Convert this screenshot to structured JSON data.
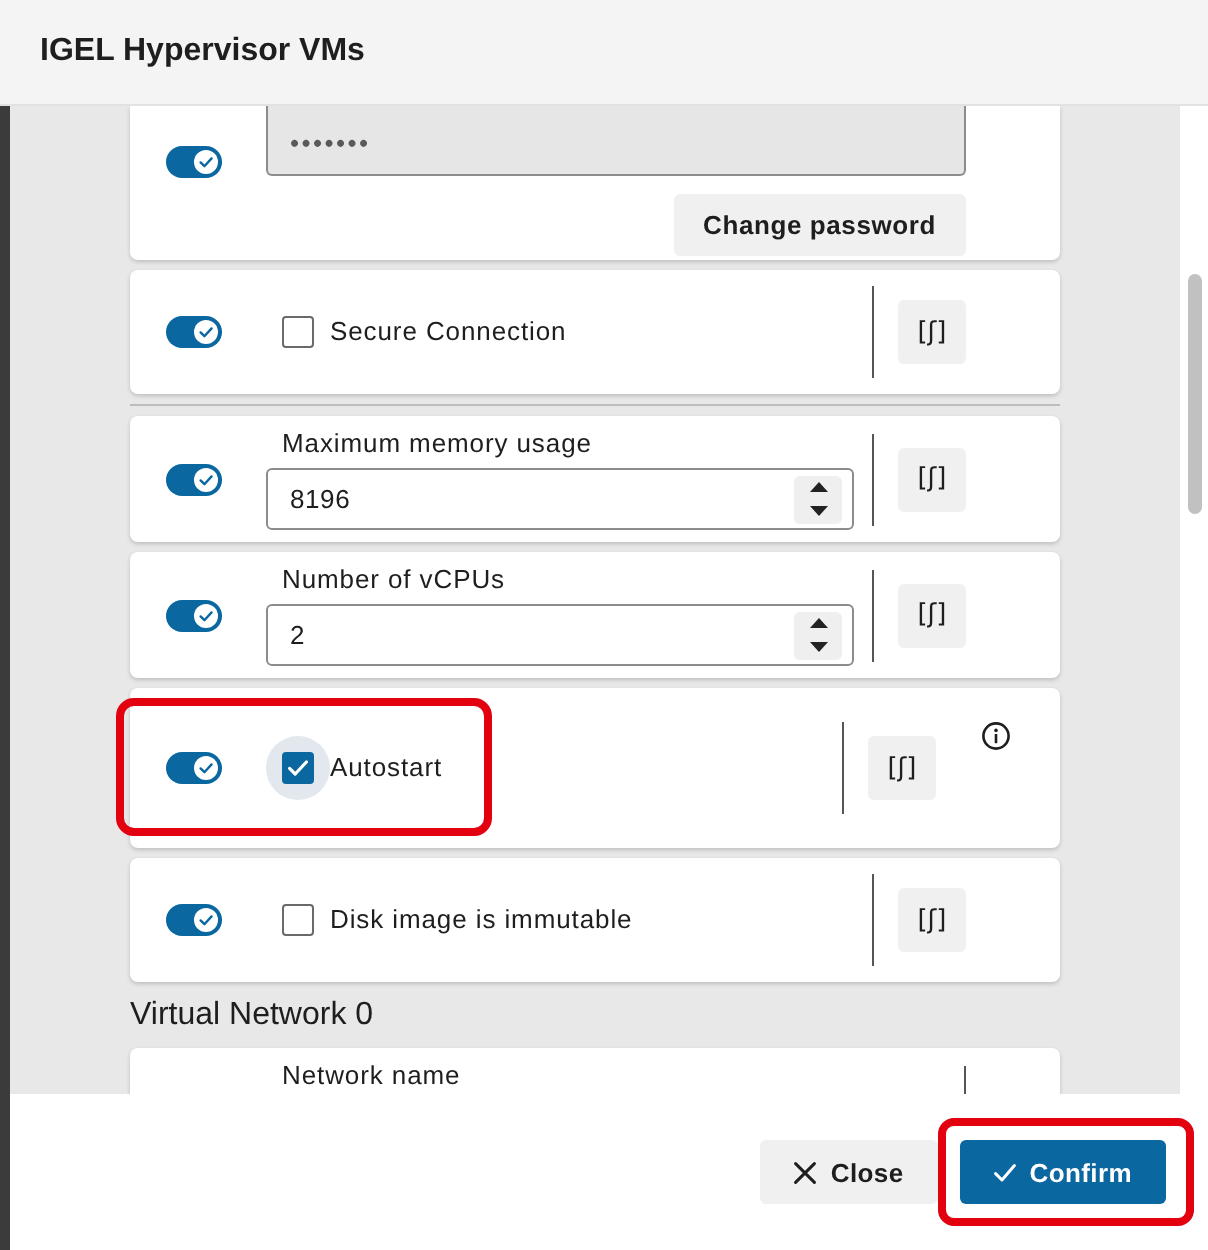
{
  "window": {
    "title": "IGEL Hypervisor VMs"
  },
  "groups": [
    {
      "settings": [
        {
          "kind": "password",
          "enabled": true,
          "value": "•••••••",
          "button": "Change password",
          "info": false,
          "highlighted": false
        },
        {
          "kind": "checkbox",
          "enabled": true,
          "label": "Secure Connection",
          "checked": false,
          "focused": false,
          "action": "[ʃ]",
          "info": false,
          "highlighted": false
        }
      ]
    },
    {
      "settings": [
        {
          "kind": "number",
          "enabled": true,
          "label": "Maximum memory usage",
          "value": "8196",
          "action": "[ʃ]",
          "info": false,
          "highlighted": false
        },
        {
          "kind": "number",
          "enabled": true,
          "label": "Number of vCPUs",
          "value": "2",
          "action": "[ʃ]",
          "info": false,
          "highlighted": false
        },
        {
          "kind": "checkbox",
          "enabled": true,
          "label": "Autostart",
          "checked": true,
          "focused": true,
          "action": "[ʃ]",
          "info": true,
          "highlighted": true
        },
        {
          "kind": "checkbox",
          "enabled": true,
          "label": "Disk image is immutable",
          "checked": false,
          "focused": false,
          "action": "[ʃ]",
          "info": false,
          "highlighted": false
        }
      ]
    }
  ],
  "sections": [
    {
      "title": "Virtual Network 0",
      "settings": [
        {
          "kind": "text",
          "label": "Network name"
        }
      ]
    }
  ],
  "footer": {
    "buttons": [
      {
        "kind": "close",
        "label": "Close",
        "highlighted": false
      },
      {
        "kind": "confirm",
        "label": "Confirm",
        "highlighted": true
      }
    ]
  }
}
